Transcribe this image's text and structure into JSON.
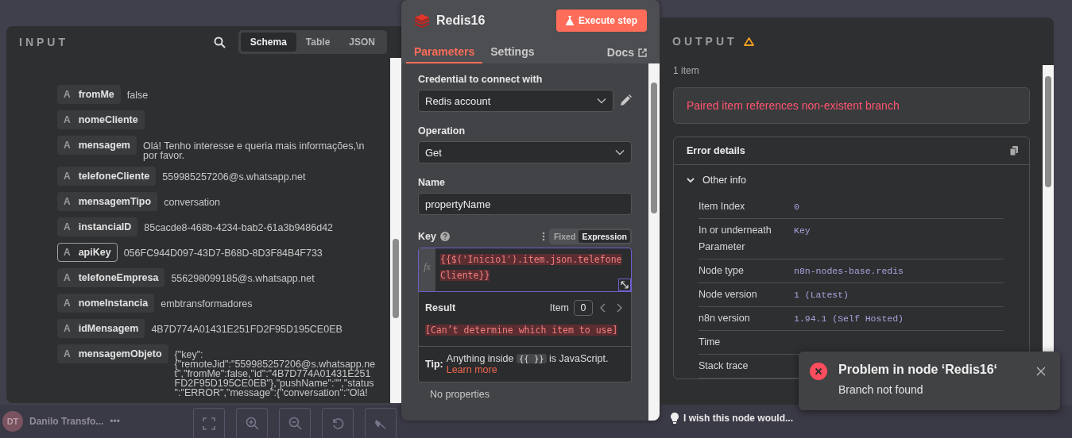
{
  "canvas": {
    "user": {
      "initials": "DT",
      "name": "Danilo Transfo...",
      "menu": "•••"
    },
    "feedback_link": "I wish this node would..."
  },
  "input_panel": {
    "title": "INPUT",
    "view_tabs": [
      {
        "label": "Schema",
        "selected": true
      },
      {
        "label": "Table",
        "selected": false
      },
      {
        "label": "JSON",
        "selected": false
      }
    ],
    "fields": [
      {
        "type": "A",
        "name": "fromMe",
        "value": "false",
        "highlighted": false
      },
      {
        "type": "A",
        "name": "nomeCliente",
        "highlighted": false
      },
      {
        "type": "A",
        "name": "mensagem",
        "value": "Olá! Tenho interesse e queria mais informações,\\n por favor.",
        "highlighted": false
      },
      {
        "type": "A",
        "name": "telefoneCliente",
        "value": "559985257206@s.whatsapp.net",
        "highlighted": false
      },
      {
        "type": "A",
        "name": "mensagemTipo",
        "value": "conversation",
        "highlighted": false
      },
      {
        "type": "A",
        "name": "instanciaID",
        "value": "85cacde8-468b-4234-bab2-61a3b9486d42",
        "highlighted": false
      },
      {
        "type": "A",
        "name": "apiKey",
        "value": "056FC944D097-43D7-B68D-8D3F84B4F733",
        "highlighted": true
      },
      {
        "type": "A",
        "name": "telefoneEmpresa",
        "value": "556298099185@s.whatsapp.net",
        "highlighted": false
      },
      {
        "type": "A",
        "name": "nomeInstancia",
        "value": "embtransformadores",
        "highlighted": false
      },
      {
        "type": "A",
        "name": "idMensagem",
        "value": "4B7D774A01431E251FD2F95D195CE0EB",
        "highlighted": false
      },
      {
        "type": "A",
        "name": "mensagemObjeto",
        "value": "{\"key\": {\"remoteJid\":\"559985257206@s.whatsapp.net\",\"fromMe\":false,\"id\":\"4B7D774A01431E251FD2F95D195CE0EB\"},\"pushName\":\"\",\"status\":\"ERROR\",\"message\":{\"conversation\":\"Olá!",
        "highlighted": false
      }
    ]
  },
  "node_panel": {
    "title": "Redis16",
    "execute_button": "Execute step",
    "tabs": [
      {
        "label": "Parameters",
        "selected": true
      },
      {
        "label": "Settings",
        "selected": false
      }
    ],
    "docs_link": "Docs",
    "credential": {
      "label": "Credential to connect with",
      "value": "Redis account"
    },
    "operation": {
      "label": "Operation",
      "value": "Get"
    },
    "name": {
      "label": "Name",
      "value": "propertyName"
    },
    "key": {
      "label": "Key",
      "modes": [
        {
          "label": "Fixed",
          "selected": false
        },
        {
          "label": "Expression",
          "selected": true
        }
      ],
      "fx": "fx",
      "expression": "{{$('Inicio1').item.json.telefoneCliente}}",
      "result_label": "Result",
      "item_label": "Item",
      "item_value": "0",
      "result": "[Can’t determine which item to use]",
      "tip": {
        "label": "Tip:",
        "text_before": "Anything inside",
        "code": "{{ }}",
        "text_after": "is JavaScript.",
        "link": "Learn more"
      }
    },
    "no_properties": "No properties"
  },
  "output_panel": {
    "title": "OUTPUT",
    "item_count": "1 item",
    "error_message": "Paired item references non-existent branch",
    "details": {
      "title": "Error details",
      "section": {
        "label": "Other info",
        "expanded": true
      },
      "rows": [
        {
          "label": "Item Index",
          "value": "0"
        },
        {
          "label": "In or underneath Parameter",
          "value": "Key"
        },
        {
          "label": "Node type",
          "value": "n8n-nodes-base.redis"
        },
        {
          "label": "Node version",
          "value": "1 (Latest)"
        },
        {
          "label": "n8n version",
          "value": "1.94.1 (Self Hosted)"
        },
        {
          "label": "Time"
        },
        {
          "label": "Stack trace"
        }
      ]
    }
  },
  "toast": {
    "title": "Problem in node ‘Redis16‘",
    "message": "Branch not found"
  }
}
